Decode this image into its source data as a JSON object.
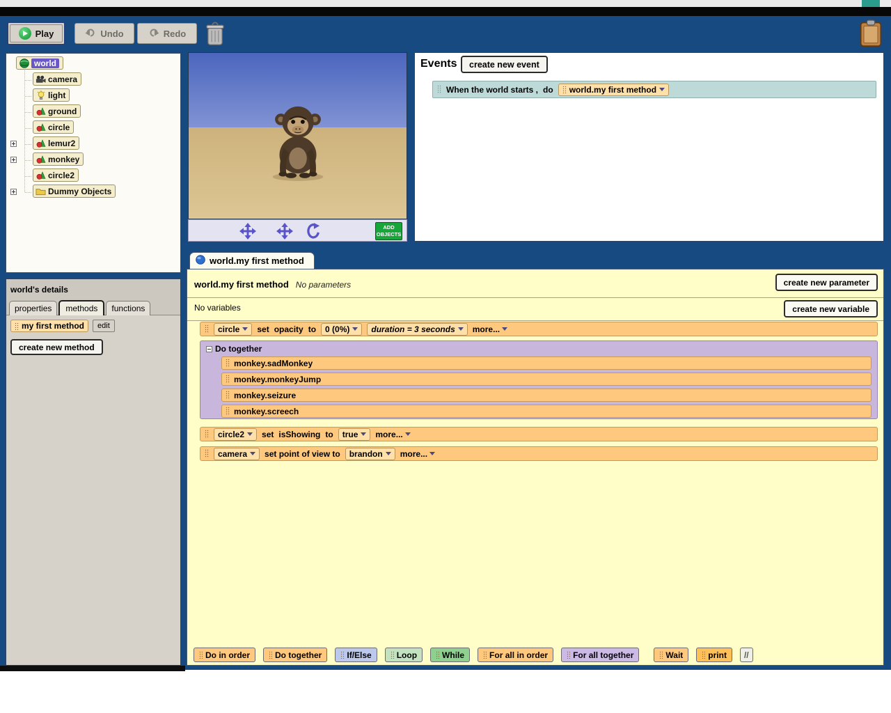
{
  "colors": {
    "app_background": "#174a80",
    "editor_background": "#fffdc8",
    "statement_orange": "#fec87e",
    "do_together_lavender": "#c9b6dd",
    "event_row_teal": "#bedad8",
    "add_objects_green": "#18a53a",
    "selected_object_purple": "#6a58c8",
    "corner_box_green": "#2a9d8f"
  },
  "toolbar": {
    "play": "Play",
    "undo": "Undo",
    "redo": "Redo",
    "icons": {
      "play": "play-icon",
      "undo": "undo-arrow-icon",
      "redo": "redo-arrow-icon",
      "trash": "trash-icon",
      "clipboard": "clipboard-icon"
    }
  },
  "object_tree": {
    "items": [
      {
        "label": "world",
        "icon": "globe-icon",
        "selected": true
      },
      {
        "label": "camera",
        "icon": "camera-icon"
      },
      {
        "label": "light",
        "icon": "lightbulb-icon"
      },
      {
        "label": "ground",
        "icon": "object-icon"
      },
      {
        "label": "circle",
        "icon": "object-icon"
      },
      {
        "label": "lemur2",
        "icon": "object-icon",
        "expandable": true
      },
      {
        "label": "monkey",
        "icon": "object-icon",
        "expandable": true
      },
      {
        "label": "circle2",
        "icon": "object-icon"
      },
      {
        "label": "Dummy Objects",
        "icon": "folder-icon",
        "expandable": true
      }
    ]
  },
  "scene": {
    "add_objects": "ADD OBJECTS"
  },
  "events": {
    "title": "Events",
    "create_new_event": "create new event",
    "when_text": "When the world starts ,",
    "do_text": "do",
    "method": "world.my first method"
  },
  "details": {
    "title": "world's details",
    "tab_properties": "properties",
    "tab_methods": "methods",
    "tab_functions": "functions",
    "method_tile": "my first method",
    "edit": "edit",
    "create_new_method": "create new method"
  },
  "editor": {
    "tab": "world.my first method",
    "title": "world.my first method",
    "no_parameters": "No parameters",
    "create_new_parameter": "create new parameter",
    "no_variables": "No variables",
    "create_new_variable": "create new variable",
    "stmt_circle": {
      "object": "circle",
      "kw_set": "set",
      "property": "opacity",
      "kw_to": "to",
      "value": "0 (0%)",
      "duration": "duration = 3 seconds",
      "more": "more..."
    },
    "do_together": {
      "label": "Do together",
      "children": [
        "monkey.sadMonkey",
        "monkey.monkeyJump",
        "monkey.seizure",
        "monkey.screech"
      ]
    },
    "stmt_circle2": {
      "object": "circle2",
      "kw_set": "set",
      "property": "isShowing",
      "kw_to": "to",
      "value": "true",
      "more": "more..."
    },
    "stmt_camera": {
      "object": "camera",
      "phrase": "set point of view to",
      "value": "brandon",
      "more": "more..."
    },
    "tiles": [
      {
        "label": "Do in order",
        "color": "#ffc87d"
      },
      {
        "label": "Do together",
        "color": "#ffc87d"
      },
      {
        "label": "If/Else",
        "color": "#bcc8ec"
      },
      {
        "label": "Loop",
        "color": "#c2e2c0"
      },
      {
        "label": "While",
        "color": "#8ed08e"
      },
      {
        "label": "For all in order",
        "color": "#ffc87d"
      },
      {
        "label": "For all together",
        "color": "#cdb9e6"
      },
      {
        "label": "Wait",
        "color": "#ffc87d"
      },
      {
        "label": "print",
        "color": "#ffc157"
      },
      {
        "label": "//",
        "color": "#f0efe6"
      }
    ]
  }
}
